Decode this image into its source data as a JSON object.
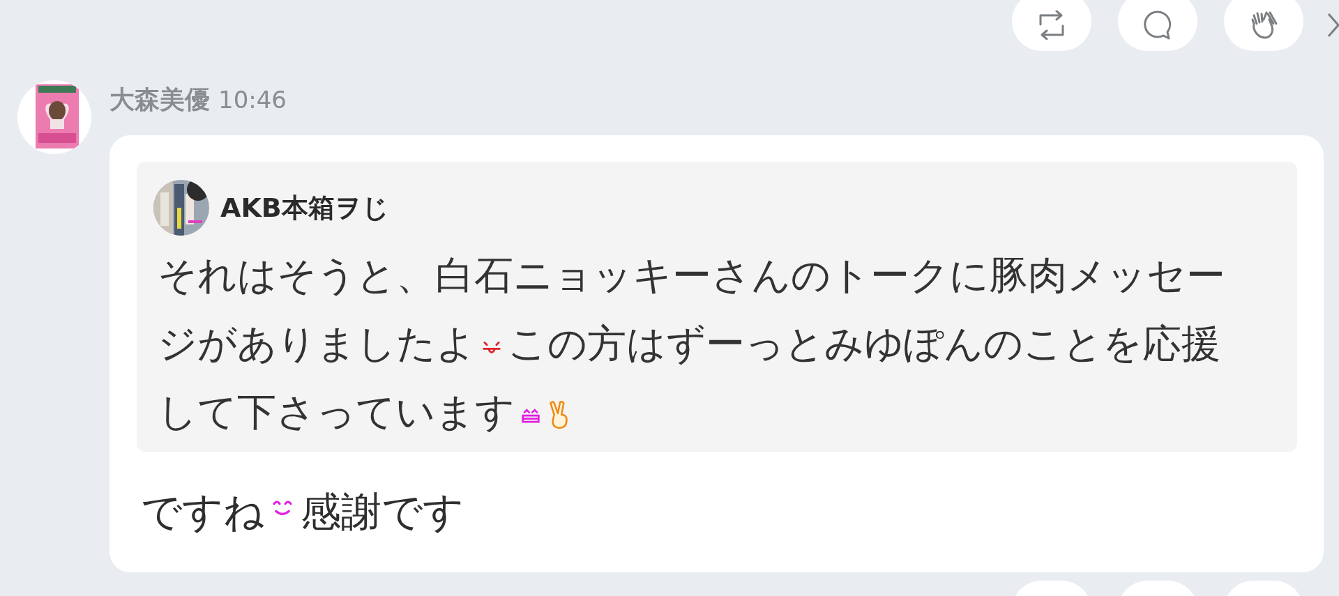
{
  "top_actions": [
    {
      "kind": "repost"
    },
    {
      "kind": "comment"
    },
    {
      "kind": "clap"
    }
  ],
  "message": {
    "author": "大森美優",
    "time": "10:46",
    "quote": {
      "author": "AKB本箱ヲじ",
      "body": [
        {
          "kind": "text",
          "text": "それはそうと、白石ニョッキーさんのトークに豚肉メッセージがありましたよ"
        },
        {
          "kind": "tongue-face"
        },
        {
          "kind": "text",
          "text": "この方はずーっとみゆぽんのことを応援して下さっています"
        },
        {
          "kind": "grin-face"
        },
        {
          "kind": "peace-hand"
        }
      ]
    },
    "body": [
      {
        "kind": "text",
        "text": "ですね"
      },
      {
        "kind": "smile-face"
      },
      {
        "kind": "text",
        "text": "感謝です"
      }
    ]
  }
}
